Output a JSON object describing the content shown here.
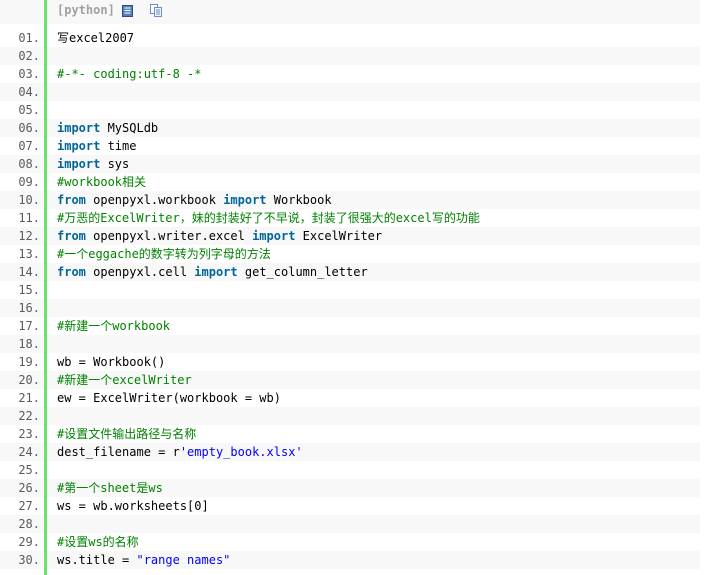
{
  "toolbar": {
    "language_label": "[python]",
    "view_plain_icon": "view-plain-icon",
    "copy_icon": "copy-icon"
  },
  "colors": {
    "gutter": "#6ce26c",
    "keyword": "#006699",
    "comment": "#008200",
    "string": "#0000ff",
    "line_number": "#5c5c5c"
  },
  "lines": [
    {
      "num": "01.",
      "tokens": [
        {
          "t": "plain",
          "v": "写excel2007"
        }
      ]
    },
    {
      "num": "02.",
      "tokens": []
    },
    {
      "num": "03.",
      "tokens": [
        {
          "t": "cm",
          "v": "#-*- coding:utf-8 -*"
        }
      ]
    },
    {
      "num": "04.",
      "tokens": []
    },
    {
      "num": "05.",
      "tokens": []
    },
    {
      "num": "06.",
      "tokens": [
        {
          "t": "kw",
          "v": "import"
        },
        {
          "t": "plain",
          "v": " MySQLdb"
        }
      ]
    },
    {
      "num": "07.",
      "tokens": [
        {
          "t": "kw",
          "v": "import"
        },
        {
          "t": "plain",
          "v": " time"
        }
      ]
    },
    {
      "num": "08.",
      "tokens": [
        {
          "t": "kw",
          "v": "import"
        },
        {
          "t": "plain",
          "v": " sys"
        }
      ]
    },
    {
      "num": "09.",
      "tokens": [
        {
          "t": "cm",
          "v": "#workbook相关"
        }
      ]
    },
    {
      "num": "10.",
      "tokens": [
        {
          "t": "kw",
          "v": "from"
        },
        {
          "t": "plain",
          "v": " openpyxl.workbook "
        },
        {
          "t": "kw",
          "v": "import"
        },
        {
          "t": "plain",
          "v": " Workbook"
        }
      ]
    },
    {
      "num": "11.",
      "tokens": [
        {
          "t": "cm",
          "v": "#万恶的ExcelWriter，妹的封装好了不早说，封装了很强大的excel写的功能"
        }
      ]
    },
    {
      "num": "12.",
      "tokens": [
        {
          "t": "kw",
          "v": "from"
        },
        {
          "t": "plain",
          "v": " openpyxl.writer.excel "
        },
        {
          "t": "kw",
          "v": "import"
        },
        {
          "t": "plain",
          "v": " ExcelWriter"
        }
      ]
    },
    {
      "num": "13.",
      "tokens": [
        {
          "t": "cm",
          "v": "#一个eggache的数字转为列字母的方法"
        }
      ]
    },
    {
      "num": "14.",
      "tokens": [
        {
          "t": "kw",
          "v": "from"
        },
        {
          "t": "plain",
          "v": " openpyxl.cell "
        },
        {
          "t": "kw",
          "v": "import"
        },
        {
          "t": "plain",
          "v": " get_column_letter"
        }
      ]
    },
    {
      "num": "15.",
      "tokens": []
    },
    {
      "num": "16.",
      "tokens": []
    },
    {
      "num": "17.",
      "tokens": [
        {
          "t": "cm",
          "v": "#新建一个workbook"
        }
      ]
    },
    {
      "num": "18.",
      "tokens": []
    },
    {
      "num": "19.",
      "tokens": [
        {
          "t": "plain",
          "v": "wb = Workbook()"
        }
      ]
    },
    {
      "num": "20.",
      "tokens": [
        {
          "t": "cm",
          "v": "#新建一个excelWriter"
        }
      ]
    },
    {
      "num": "21.",
      "tokens": [
        {
          "t": "plain",
          "v": "ew = ExcelWriter(workbook = wb)"
        }
      ]
    },
    {
      "num": "22.",
      "tokens": []
    },
    {
      "num": "23.",
      "tokens": [
        {
          "t": "cm",
          "v": "#设置文件输出路径与名称"
        }
      ]
    },
    {
      "num": "24.",
      "tokens": [
        {
          "t": "plain",
          "v": "dest_filename = r"
        },
        {
          "t": "st",
          "v": "'empty_book.xlsx'"
        }
      ]
    },
    {
      "num": "25.",
      "tokens": []
    },
    {
      "num": "26.",
      "tokens": [
        {
          "t": "cm",
          "v": "#第一个sheet是ws"
        }
      ]
    },
    {
      "num": "27.",
      "tokens": [
        {
          "t": "plain",
          "v": "ws = wb.worksheets[0]"
        }
      ]
    },
    {
      "num": "28.",
      "tokens": []
    },
    {
      "num": "29.",
      "tokens": [
        {
          "t": "cm",
          "v": "#设置ws的名称"
        }
      ]
    },
    {
      "num": "30.",
      "tokens": [
        {
          "t": "plain",
          "v": "ws.title = "
        },
        {
          "t": "st",
          "v": "\"range names\""
        }
      ]
    }
  ]
}
